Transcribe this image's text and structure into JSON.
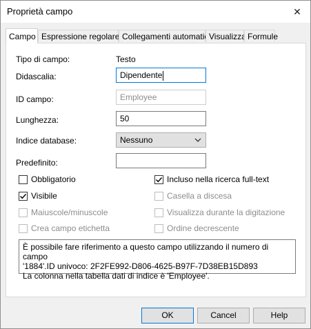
{
  "window": {
    "title": "Proprietà campo",
    "close_icon": "close-icon"
  },
  "tabs": [
    {
      "label": "Campo",
      "active": true
    },
    {
      "label": "Espressione regolare",
      "active": false
    },
    {
      "label": "Collegamenti automatici",
      "active": false
    },
    {
      "label": "Visualizza",
      "active": false
    },
    {
      "label": "Formule",
      "active": false
    }
  ],
  "form": {
    "field_type_label": "Tipo di campo:",
    "field_type_value": "Testo",
    "caption_label": "Didascalia:",
    "caption_value": "Dipendente",
    "field_id_label": "ID campo:",
    "field_id_value": "Employee",
    "length_label": "Lunghezza:",
    "length_value": "50",
    "db_index_label": "Indice database:",
    "db_index_value": "Nessuno",
    "default_label": "Predefinito:",
    "default_value": ""
  },
  "checkboxes": {
    "required": {
      "label": "Obbligatorio",
      "checked": false,
      "enabled": true
    },
    "fulltext": {
      "label": "Incluso nella ricerca full-text",
      "checked": true,
      "enabled": true
    },
    "visible": {
      "label": "Visibile",
      "checked": true,
      "enabled": true
    },
    "dropdown": {
      "label": "Casella a discesa",
      "checked": false,
      "enabled": false
    },
    "case": {
      "label": "Maiuscole/minuscole",
      "checked": false,
      "enabled": false
    },
    "show_typing": {
      "label": "Visualizza durante la digitazione",
      "checked": false,
      "enabled": false
    },
    "label_field": {
      "label": "Crea campo etichetta",
      "checked": false,
      "enabled": false
    },
    "descending": {
      "label": "Ordine decrescente",
      "checked": false,
      "enabled": false
    }
  },
  "info": {
    "line1": "È possibile fare riferimento a questo campo utilizzando il numero di campo",
    "line2": "'1884'.ID univoco: 2F2FE992-D806-4625-B97F-7D38EB15D893",
    "line3": "La colonna nella tabella dati di indice è 'Employee'."
  },
  "buttons": {
    "ok": "OK",
    "cancel": "Cancel",
    "help": "Help"
  },
  "colors": {
    "focus_border": "#0078d7",
    "dialog_bg": "#f0f0f0"
  }
}
